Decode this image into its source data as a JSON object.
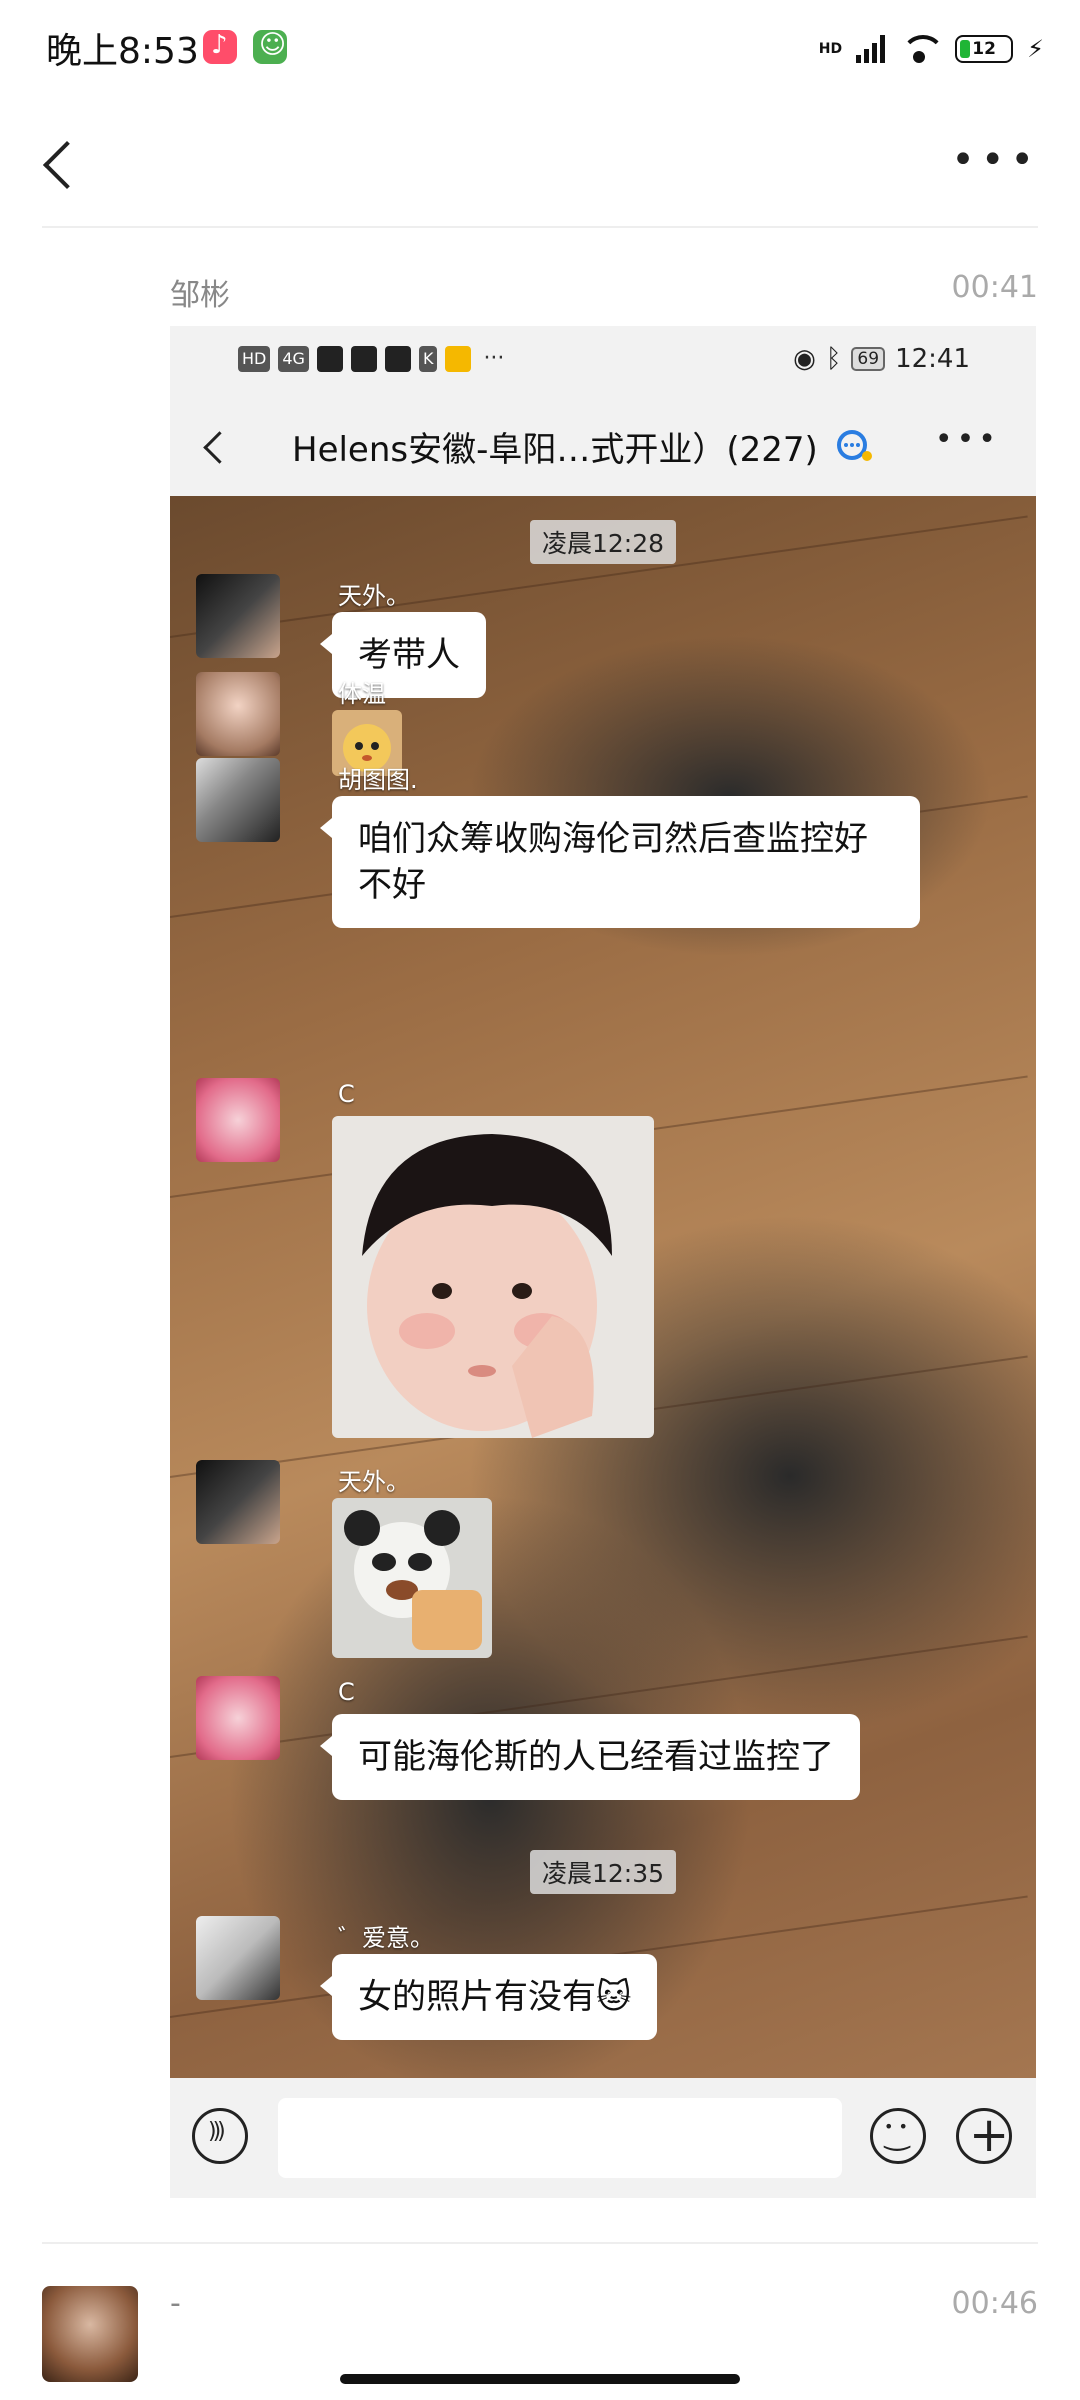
{
  "status_bar": {
    "time": "晚上8:53",
    "network": "HD",
    "battery": "12"
  },
  "post": {
    "author": "邹彬",
    "time": "00:41"
  },
  "inner": {
    "status_bar": {
      "left_badges": [
        "HD",
        "4G",
        "K"
      ],
      "more": "···",
      "time": "12:41",
      "battery": "69"
    },
    "chat_title": "Helens安徽-阜阳…式开业）(227)",
    "messages": [
      {
        "type": "time",
        "text": "凌晨12:28"
      },
      {
        "type": "text",
        "sender": "天外。",
        "text": "考带人"
      },
      {
        "type": "sticker",
        "sender": "体温",
        "sticker": "cartoon-face-sticker"
      },
      {
        "type": "text",
        "sender": "胡图图.",
        "text": "咱们众筹收购海伦司然后查监控好不好"
      },
      {
        "type": "sticker",
        "sender": "C",
        "sticker": "baby-photo-sticker"
      },
      {
        "type": "sticker",
        "sender": "天外。",
        "sticker": "panda-meme-sticker"
      },
      {
        "type": "text",
        "sender": "C",
        "text": "可能海伦斯的人已经看过监控了"
      },
      {
        "type": "time",
        "text": "凌晨12:35"
      },
      {
        "type": "text",
        "sender": "゛爱意。",
        "text": "女的照片有没有🐱"
      }
    ]
  },
  "comment2": {
    "author": "-",
    "time": "00:46"
  },
  "colors": {
    "bubble": "#ffffff",
    "chat_bg": "#8e6240",
    "accent_qq": "#2a7de1"
  }
}
